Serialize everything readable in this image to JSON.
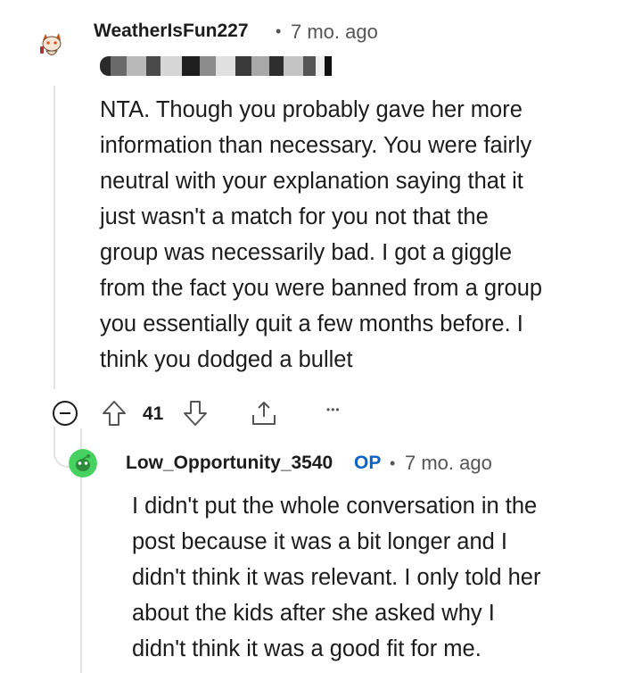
{
  "comment1": {
    "username": "WeatherIsFun227",
    "separator": "•",
    "time": "7 mo. ago",
    "body": "NTA. Though you probably gave her more\ninformation than necessary. You were fairly\nneutral with your explanation saying that it\njust wasn't a match for you not that the\ngroup was necessarily bad. I got a giggle\nfrom the fact you were banned from a group\nyou essentially quit a few months before. I\nthink you dodged a bullet",
    "collapse_symbol": "−",
    "vote_count": "41",
    "more_symbol": "•••"
  },
  "comment2": {
    "username": "Low_Opportunity_3540",
    "op_badge": "OP",
    "separator": "•",
    "time": "7 mo. ago",
    "body": "I didn't put the whole conversation in the\npost because it was a bit longer and I\ndidn't think it was relevant. I only told her\nabout the kids after she asked why I\ndidn't think it was a good fit for me."
  },
  "icons": {
    "avatar1": "snoo-avatar-icon",
    "avatar2": "snoo-green-avatar-icon",
    "collapse": "collapse-icon",
    "upvote": "upvote-icon",
    "downvote": "downvote-icon",
    "share": "share-icon",
    "more": "more-options-icon"
  },
  "colors": {
    "op_badge": "#0b63c6",
    "green_avatar": "#46d160",
    "thread_line": "#e3e3e3"
  }
}
